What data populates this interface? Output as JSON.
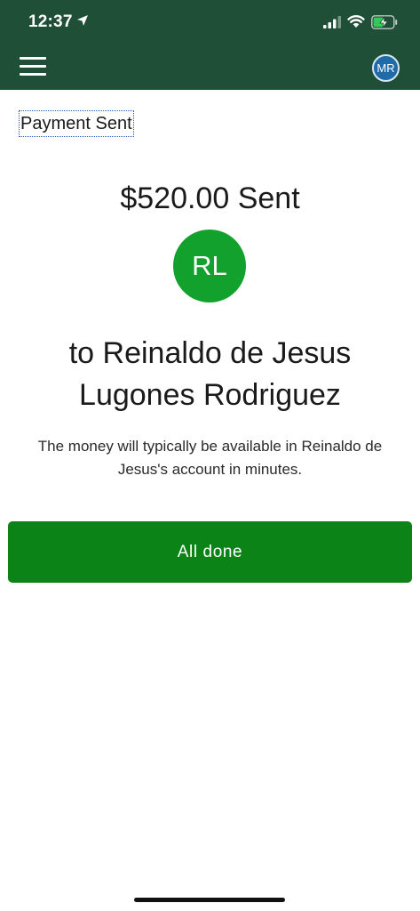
{
  "status_bar": {
    "time": "12:37",
    "icons": [
      "location-arrow-icon",
      "signal-icon",
      "wifi-icon",
      "battery-charging-icon"
    ]
  },
  "header": {
    "menu_icon": "hamburger-menu-icon",
    "avatar_initials": "MR"
  },
  "page": {
    "title": "Payment Sent",
    "amount_sent": "$520.00 Sent",
    "recipient_initials": "RL",
    "recipient_line": "to Reinaldo de Jesus Lugones Rodriguez",
    "info": "The money will typically be available in Reinaldo de Jesus's account in minutes.",
    "done_label": "All done"
  },
  "colors": {
    "header_bg": "#1f4f37",
    "recipient_avatar": "#12a12d",
    "done_button": "#0b8316",
    "header_avatar": "#1f6aa8"
  }
}
